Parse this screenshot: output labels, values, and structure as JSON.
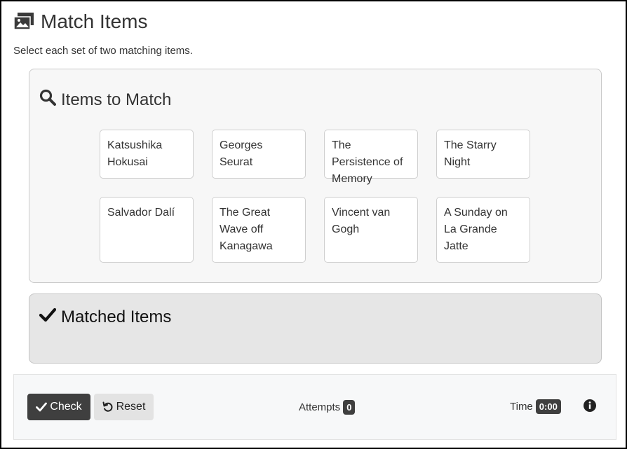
{
  "header": {
    "title": "Match Items",
    "title_icon": "images-icon",
    "instructions": "Select each set of two matching items."
  },
  "items_panel": {
    "heading": "Items to Match",
    "heading_icon": "search-icon",
    "cards": [
      {
        "label": "Katsushika Hokusai"
      },
      {
        "label": "Georges Seurat"
      },
      {
        "label": "The Persistence of Memory"
      },
      {
        "label": "The Starry Night"
      },
      {
        "label": "Salvador Dalí"
      },
      {
        "label": "The Great Wave off Kanagawa"
      },
      {
        "label": "Vincent van Gogh"
      },
      {
        "label": "A Sunday on La Grande Jatte"
      }
    ]
  },
  "matched_panel": {
    "heading": "Matched Items",
    "heading_icon": "check-icon"
  },
  "footer": {
    "check_label": "Check",
    "reset_label": "Reset",
    "attempts_label": "Attempts",
    "attempts_value": "0",
    "time_label": "Time",
    "time_value": "0:00",
    "info_icon": "info-icon"
  },
  "colors": {
    "dark_button": "#3f3f3f",
    "items_panel_bg": "#f7f7f7",
    "matched_panel_bg": "#e6e6e6"
  }
}
